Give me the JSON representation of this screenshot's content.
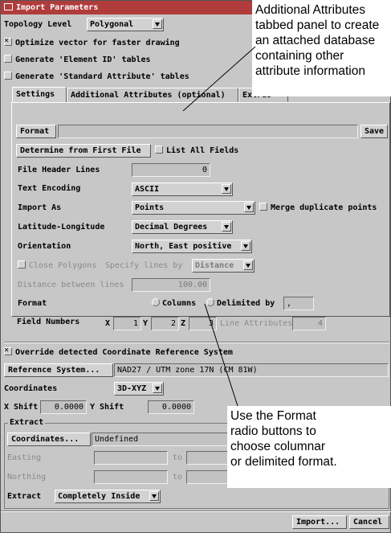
{
  "window": {
    "title": "Import Parameters"
  },
  "top": {
    "topology_label": "Topology Level",
    "topology_value": "Polygonal",
    "optimize_label": "Optimize vector for faster drawing",
    "element_id_label": "Generate 'Element ID' tables",
    "standard_attr_label": "Generate 'Standard Attribute' tables"
  },
  "tabs": [
    {
      "label": "Settings"
    },
    {
      "label": "Additional Attributes (optional)"
    },
    {
      "label": "Extras"
    }
  ],
  "settings": {
    "format_button": "Format",
    "format_value": "",
    "save_button": "Save",
    "determine_button": "Determine from First File",
    "list_all_label": "List All Fields",
    "file_header_label": "File Header Lines",
    "file_header_value": "0",
    "text_encoding_label": "Text Encoding",
    "text_encoding_value": "ASCII",
    "import_as_label": "Import As",
    "import_as_value": "Points",
    "merge_label": "Merge duplicate points",
    "latlon_label": "Latitude-Longitude",
    "latlon_value": "Decimal Degrees",
    "orientation_label": "Orientation",
    "orientation_value": "North, East positive",
    "close_polygons_label": "Close Polygons",
    "specify_lines_label": "Specify lines by",
    "specify_lines_value": "Distance",
    "distance_lines_label": "Distance between lines",
    "distance_lines_value": "100.00",
    "format_label": "Format",
    "columns_label": "Columns",
    "delimited_label": "Delimited by",
    "delimiter_value": ",",
    "field_numbers_label": "Field Numbers",
    "x_label": "X",
    "x_value": "1",
    "y_label": "Y",
    "y_value": "2",
    "z_label": "Z",
    "z_value": "3",
    "line_attr_label": "Line Attributes",
    "line_attr_value": "4"
  },
  "coord": {
    "override_label": "Override detected Coordinate Reference System",
    "ref_button": "Reference System...",
    "ref_value": "NAD27 / UTM zone 17N (CM 81W)",
    "coordinates_label": "Coordinates",
    "coordinates_value": "3D-XYZ",
    "xshift_label": "X Shift",
    "xshift_value": "0.0000",
    "yshift_label": "Y Shift",
    "yshift_value": "0.0000"
  },
  "extract": {
    "group_label": "Extract",
    "coordinates_button": "Coordinates...",
    "coordinates_value": "Undefined",
    "easting_label": "Easting",
    "northing_label": "Northing",
    "to_label": "to",
    "extract_label": "Extract",
    "extract_value": "Completely Inside"
  },
  "footer": {
    "import_button": "Import...",
    "cancel_button": "Cancel"
  },
  "callouts": {
    "top_text": "Additional Attributes tabbed panel to create an attached database containing other attribute information",
    "top_lines": [
      "Additional Attributes",
      "tabbed panel to create",
      "an attached database",
      "containing other",
      "attribute information"
    ],
    "bottom_lines": [
      "Use the Format",
      "radio buttons to",
      "choose columnar",
      "or delimited format."
    ]
  }
}
